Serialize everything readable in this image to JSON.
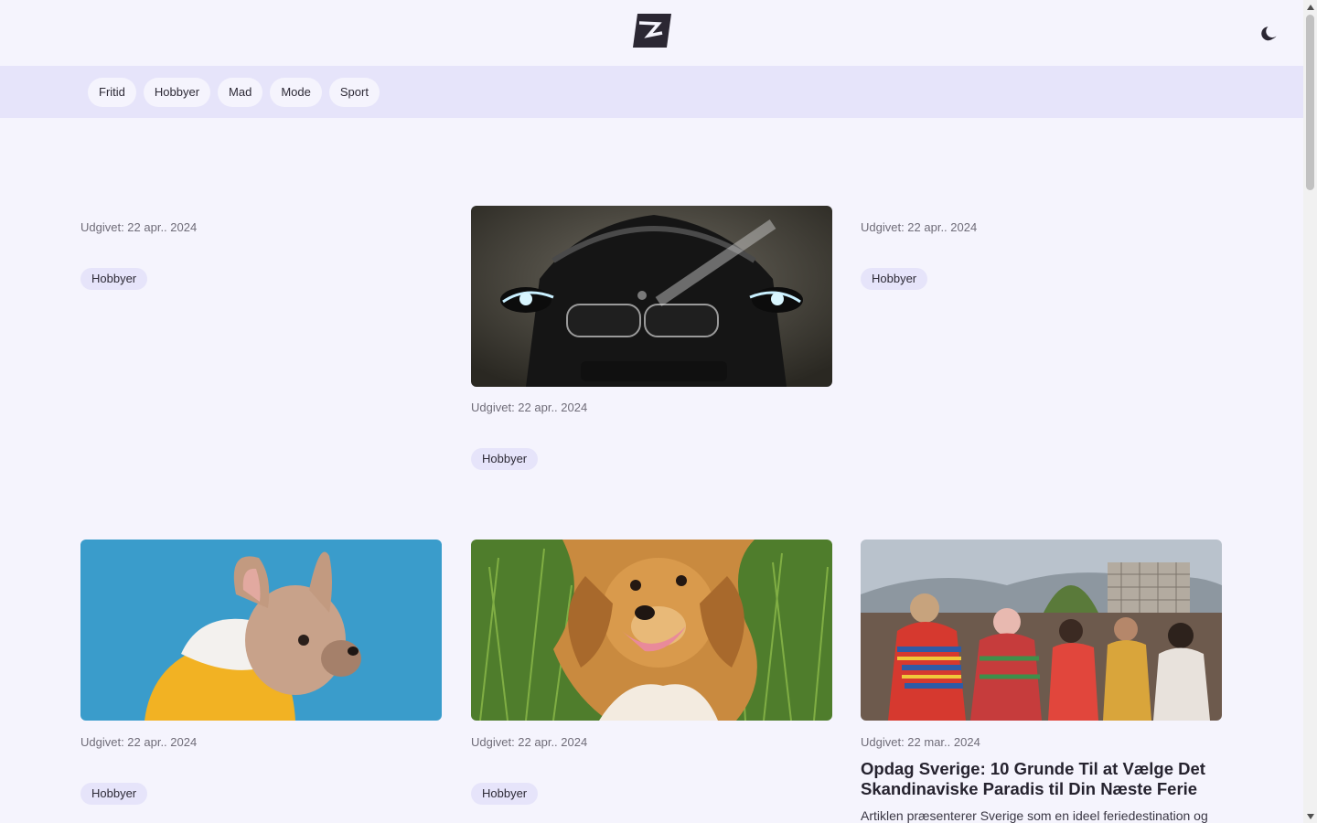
{
  "header": {
    "logo_icon": "brand-logo-icon",
    "theme_icon": "moon-icon"
  },
  "categories": [
    {
      "label": "Fritid"
    },
    {
      "label": "Hobbyer"
    },
    {
      "label": "Mad"
    },
    {
      "label": "Mode"
    },
    {
      "label": "Sport"
    }
  ],
  "cards": [
    {
      "date": "Udgivet: 22 apr.. 2024",
      "tag": "Hobbyer",
      "image": null
    },
    {
      "date": "Udgivet: 22 apr.. 2024",
      "tag": "Hobbyer",
      "image": "car-headlights-photo"
    },
    {
      "date": "Udgivet: 22 apr.. 2024",
      "tag": "Hobbyer",
      "image": null
    },
    {
      "date": "Udgivet: 22 apr.. 2024",
      "tag": "Hobbyer",
      "image": "french-bulldog-hoodie-photo"
    },
    {
      "date": "Udgivet: 22 apr.. 2024",
      "tag": "Hobbyer",
      "image": "dog-in-grass-photo"
    },
    {
      "date": "Udgivet: 22 mar.. 2024",
      "image": "festival-crowd-photo",
      "title": "Opdag Sverige: 10 Grunde Til at Vælge Det Skandinaviske Paradis til Din Næste Ferie",
      "excerpt": "Artiklen præsenterer Sverige som en ideel feriedestination og"
    }
  ],
  "colors": {
    "background": "#f5f4fd",
    "category_bar": "#e6e4fa",
    "pill": "#e6e4fa",
    "text": "#26232f",
    "muted": "#6f6c78"
  }
}
